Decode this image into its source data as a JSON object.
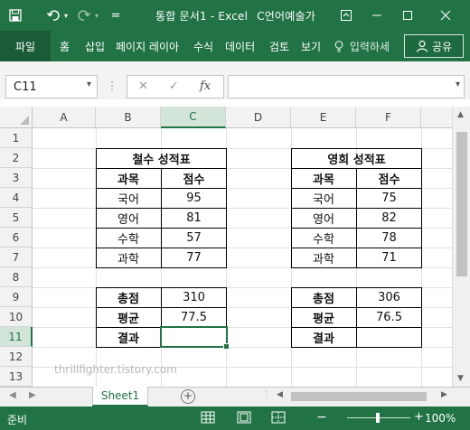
{
  "titlebar": {
    "title": "통합 문서1  -  Excel",
    "user": "C언어예술가",
    "customize_label": "=",
    "ribbon_display_icon": "ribbon-display-icon",
    "minimize_icon": "minimize-icon",
    "maximize_icon": "maximize-icon",
    "close_icon": "close-icon"
  },
  "ribbon": {
    "file_tab": "파일",
    "tabs": [
      "홈",
      "삽입",
      "페이지 레이아",
      "수식",
      "데이터",
      "검토",
      "보기"
    ],
    "tell_me": "입력하세",
    "share": "공유"
  },
  "formula_bar": {
    "name_box": "C11",
    "fx": "fx",
    "formula": ""
  },
  "columns": [
    "A",
    "B",
    "C",
    "D",
    "E",
    "F"
  ],
  "rows": [
    "1",
    "2",
    "3",
    "4",
    "5",
    "6",
    "7",
    "8",
    "9",
    "10",
    "11",
    "12",
    "13"
  ],
  "active_cell": "C11",
  "table_left": {
    "title": "철수 성적표",
    "header_subject": "과목",
    "header_score": "점수",
    "rows": [
      {
        "subject": "국어",
        "score": "95"
      },
      {
        "subject": "영어",
        "score": "81"
      },
      {
        "subject": "수학",
        "score": "57"
      },
      {
        "subject": "과학",
        "score": "77"
      }
    ],
    "total_label": "총점",
    "total_value": "310",
    "avg_label": "평균",
    "avg_value": "77.5",
    "result_label": "결과",
    "result_value": ""
  },
  "table_right": {
    "title": "영희 성적표",
    "header_subject": "과목",
    "header_score": "점수",
    "rows": [
      {
        "subject": "국어",
        "score": "75"
      },
      {
        "subject": "영어",
        "score": "82"
      },
      {
        "subject": "수학",
        "score": "78"
      },
      {
        "subject": "과학",
        "score": "71"
      }
    ],
    "total_label": "총점",
    "total_value": "306",
    "avg_label": "평균",
    "avg_value": "76.5",
    "result_label": "결과",
    "result_value": ""
  },
  "watermark": "thrillfighter.tistory.com",
  "sheets": [
    "Sheet1"
  ],
  "status": {
    "ready": "준비",
    "zoom": "100%"
  },
  "colors": {
    "accent": "#217346"
  }
}
